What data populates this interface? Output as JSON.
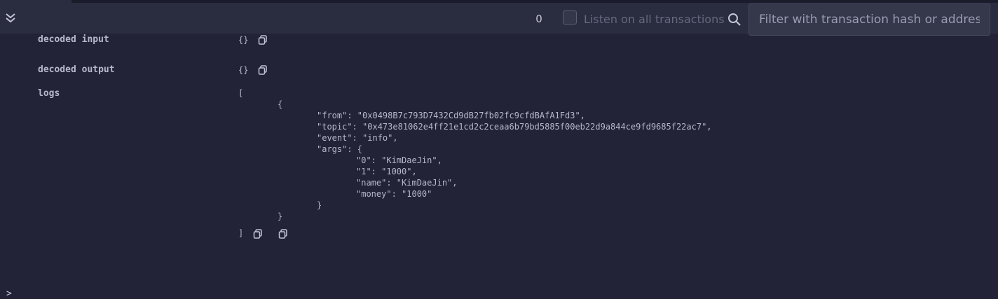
{
  "toolbar": {
    "collapse_icon": "double-chevron-down-icon",
    "pending_count": "0",
    "listen_checkbox_checked": false,
    "listen_label": "Listen on all transactions",
    "search_icon": "search-icon",
    "filter_placeholder": "Filter with transaction hash or address",
    "filter_value": ""
  },
  "details": {
    "decoded_input_label": "decoded input",
    "decoded_input_value": "{}",
    "decoded_output_label": "decoded output",
    "decoded_output_value": "{}",
    "logs_label": "logs",
    "logs_open": "[",
    "logs_close": "]",
    "logs_lines": [
      "{",
      "\"from\": \"0x0498B7c793D7432Cd9dB27fb02fc9cfdBAfA1Fd3\",",
      "\"topic\": \"0x473e81062e4ff21e1cd2c2ceaa6b79bd5885f00eb22d9a844ce9fd9685f22ac7\",",
      "\"event\": \"info\",",
      "\"args\": {",
      "\"0\": \"KimDaeJin\",",
      "\"1\": \"1000\",",
      "\"name\": \"KimDaeJin\",",
      "\"money\": \"1000\"",
      "}",
      "}"
    ]
  },
  "terminal": {
    "prompt": ">"
  },
  "colors": {
    "background": "#222336",
    "toolbar": "#2a2c3f",
    "text": "#b7b8cc"
  }
}
